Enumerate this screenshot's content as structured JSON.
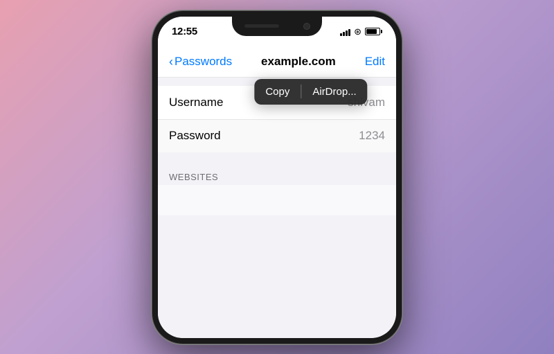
{
  "background": {
    "gradient_start": "#e8a0b0",
    "gradient_end": "#9080c0"
  },
  "status_bar": {
    "time": "12:55",
    "signal_bars": [
      4,
      6,
      8,
      10,
      12
    ],
    "battery_level": 85
  },
  "nav": {
    "back_label": "Passwords",
    "title": "example.com",
    "edit_label": "Edit"
  },
  "rows": [
    {
      "label": "Username",
      "value": "shivam"
    },
    {
      "label": "Password",
      "value": "1234"
    },
    {
      "label": "WEBSITES",
      "value": ""
    }
  ],
  "popup": {
    "copy_label": "Copy",
    "airdrop_label": "AirDrop..."
  }
}
